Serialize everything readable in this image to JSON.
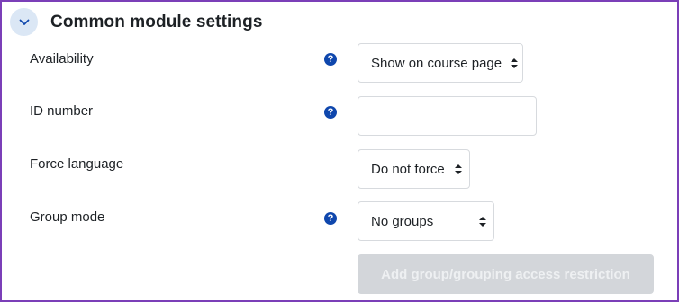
{
  "section": {
    "title": "Common module settings",
    "collapse_icon": "chevron-down-icon"
  },
  "fields": {
    "availability": {
      "label": "Availability",
      "value": "Show on course page",
      "help_icon": "question-circle-icon"
    },
    "id_number": {
      "label": "ID number",
      "value": "",
      "help_icon": "question-circle-icon"
    },
    "force_language": {
      "label": "Force language",
      "value": "Do not force"
    },
    "group_mode": {
      "label": "Group mode",
      "value": "No groups",
      "help_icon": "question-circle-icon"
    }
  },
  "actions": {
    "add_restriction_label": "Add group/grouping access restriction",
    "add_restriction_disabled": true
  },
  "colors": {
    "accent": "#0f47ad",
    "frame_border": "#7b3fb8",
    "collapse_bg": "#dbe7f5",
    "disabled_button_bg": "#d3d6da"
  }
}
